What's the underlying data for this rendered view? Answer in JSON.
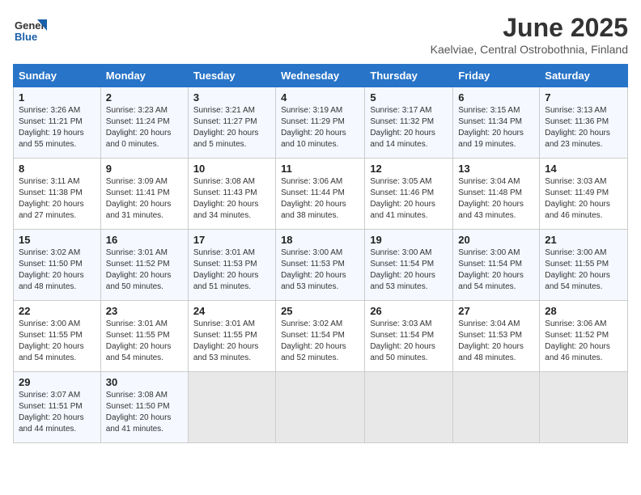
{
  "header": {
    "logo_line1": "General",
    "logo_line2": "Blue",
    "month_title": "June 2025",
    "location": "Kaelviae, Central Ostrobothnia, Finland"
  },
  "days_of_week": [
    "Sunday",
    "Monday",
    "Tuesday",
    "Wednesday",
    "Thursday",
    "Friday",
    "Saturday"
  ],
  "weeks": [
    [
      {
        "day": "1",
        "info": "Sunrise: 3:26 AM\nSunset: 11:21 PM\nDaylight: 19 hours\nand 55 minutes."
      },
      {
        "day": "2",
        "info": "Sunrise: 3:23 AM\nSunset: 11:24 PM\nDaylight: 20 hours\nand 0 minutes."
      },
      {
        "day": "3",
        "info": "Sunrise: 3:21 AM\nSunset: 11:27 PM\nDaylight: 20 hours\nand 5 minutes."
      },
      {
        "day": "4",
        "info": "Sunrise: 3:19 AM\nSunset: 11:29 PM\nDaylight: 20 hours\nand 10 minutes."
      },
      {
        "day": "5",
        "info": "Sunrise: 3:17 AM\nSunset: 11:32 PM\nDaylight: 20 hours\nand 14 minutes."
      },
      {
        "day": "6",
        "info": "Sunrise: 3:15 AM\nSunset: 11:34 PM\nDaylight: 20 hours\nand 19 minutes."
      },
      {
        "day": "7",
        "info": "Sunrise: 3:13 AM\nSunset: 11:36 PM\nDaylight: 20 hours\nand 23 minutes."
      }
    ],
    [
      {
        "day": "8",
        "info": "Sunrise: 3:11 AM\nSunset: 11:38 PM\nDaylight: 20 hours\nand 27 minutes."
      },
      {
        "day": "9",
        "info": "Sunrise: 3:09 AM\nSunset: 11:41 PM\nDaylight: 20 hours\nand 31 minutes."
      },
      {
        "day": "10",
        "info": "Sunrise: 3:08 AM\nSunset: 11:43 PM\nDaylight: 20 hours\nand 34 minutes."
      },
      {
        "day": "11",
        "info": "Sunrise: 3:06 AM\nSunset: 11:44 PM\nDaylight: 20 hours\nand 38 minutes."
      },
      {
        "day": "12",
        "info": "Sunrise: 3:05 AM\nSunset: 11:46 PM\nDaylight: 20 hours\nand 41 minutes."
      },
      {
        "day": "13",
        "info": "Sunrise: 3:04 AM\nSunset: 11:48 PM\nDaylight: 20 hours\nand 43 minutes."
      },
      {
        "day": "14",
        "info": "Sunrise: 3:03 AM\nSunset: 11:49 PM\nDaylight: 20 hours\nand 46 minutes."
      }
    ],
    [
      {
        "day": "15",
        "info": "Sunrise: 3:02 AM\nSunset: 11:50 PM\nDaylight: 20 hours\nand 48 minutes."
      },
      {
        "day": "16",
        "info": "Sunrise: 3:01 AM\nSunset: 11:52 PM\nDaylight: 20 hours\nand 50 minutes."
      },
      {
        "day": "17",
        "info": "Sunrise: 3:01 AM\nSunset: 11:53 PM\nDaylight: 20 hours\nand 51 minutes."
      },
      {
        "day": "18",
        "info": "Sunrise: 3:00 AM\nSunset: 11:53 PM\nDaylight: 20 hours\nand 53 minutes."
      },
      {
        "day": "19",
        "info": "Sunrise: 3:00 AM\nSunset: 11:54 PM\nDaylight: 20 hours\nand 53 minutes."
      },
      {
        "day": "20",
        "info": "Sunrise: 3:00 AM\nSunset: 11:54 PM\nDaylight: 20 hours\nand 54 minutes."
      },
      {
        "day": "21",
        "info": "Sunrise: 3:00 AM\nSunset: 11:55 PM\nDaylight: 20 hours\nand 54 minutes."
      }
    ],
    [
      {
        "day": "22",
        "info": "Sunrise: 3:00 AM\nSunset: 11:55 PM\nDaylight: 20 hours\nand 54 minutes."
      },
      {
        "day": "23",
        "info": "Sunrise: 3:01 AM\nSunset: 11:55 PM\nDaylight: 20 hours\nand 54 minutes."
      },
      {
        "day": "24",
        "info": "Sunrise: 3:01 AM\nSunset: 11:55 PM\nDaylight: 20 hours\nand 53 minutes."
      },
      {
        "day": "25",
        "info": "Sunrise: 3:02 AM\nSunset: 11:54 PM\nDaylight: 20 hours\nand 52 minutes."
      },
      {
        "day": "26",
        "info": "Sunrise: 3:03 AM\nSunset: 11:54 PM\nDaylight: 20 hours\nand 50 minutes."
      },
      {
        "day": "27",
        "info": "Sunrise: 3:04 AM\nSunset: 11:53 PM\nDaylight: 20 hours\nand 48 minutes."
      },
      {
        "day": "28",
        "info": "Sunrise: 3:06 AM\nSunset: 11:52 PM\nDaylight: 20 hours\nand 46 minutes."
      }
    ],
    [
      {
        "day": "29",
        "info": "Sunrise: 3:07 AM\nSunset: 11:51 PM\nDaylight: 20 hours\nand 44 minutes."
      },
      {
        "day": "30",
        "info": "Sunrise: 3:08 AM\nSunset: 11:50 PM\nDaylight: 20 hours\nand 41 minutes."
      },
      null,
      null,
      null,
      null,
      null
    ]
  ]
}
